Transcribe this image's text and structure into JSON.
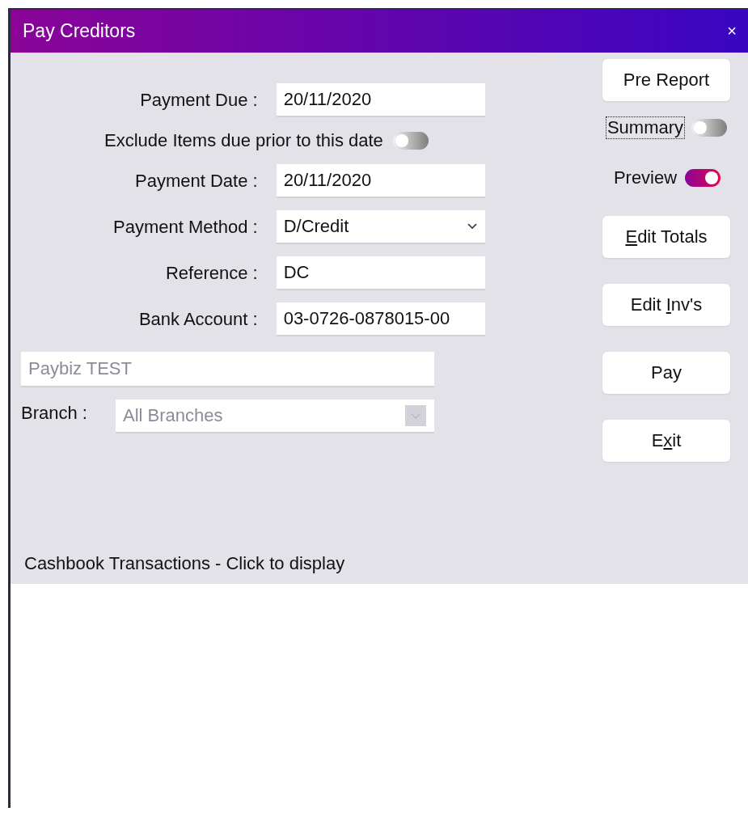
{
  "window": {
    "title": "Pay Creditors",
    "close": "×"
  },
  "form": [
    {
      "kind": "text",
      "label": "Payment Due :",
      "value": "20/11/2020"
    },
    {
      "kind": "toggle",
      "label": "Exclude Items due prior to this date",
      "on": false
    },
    {
      "kind": "text",
      "label": "Payment Date :",
      "value": "20/11/2020"
    },
    {
      "kind": "select",
      "label": "Payment Method :",
      "value": "D/Credit",
      "disabled": false
    },
    {
      "kind": "text",
      "label": "Reference :",
      "value": "DC"
    },
    {
      "kind": "text",
      "label": "Bank Account :",
      "value": "03-0726-0878015-00"
    },
    {
      "kind": "wide",
      "value": "Paybiz TEST",
      "disabled": true
    },
    {
      "kind": "branch",
      "label": "Branch :",
      "value": "All Branches",
      "disabled": true
    }
  ],
  "actions": [
    {
      "kind": "button",
      "label": "Pre Report"
    },
    {
      "kind": "toggle",
      "label": "Summary",
      "on": false,
      "focused": true
    },
    {
      "kind": "toggle",
      "label": "Preview",
      "on": true,
      "focused": false
    },
    {
      "kind": "button",
      "parts": [
        {
          "text": "E",
          "underlined": true
        },
        {
          "text": "dit Totals",
          "underlined": false
        }
      ]
    },
    {
      "kind": "button",
      "parts": [
        {
          "text": "Edit ",
          "underlined": false
        },
        {
          "text": "I",
          "underlined": true
        },
        {
          "text": "nv's",
          "underlined": false
        }
      ]
    },
    {
      "kind": "button",
      "label": "Pay"
    },
    {
      "kind": "button",
      "parts": [
        {
          "text": "E",
          "underlined": false
        },
        {
          "text": "x",
          "underlined": true
        },
        {
          "text": "it",
          "underlined": false
        }
      ]
    }
  ],
  "cashbook": {
    "label": "Cashbook Transactions - Click to display"
  }
}
